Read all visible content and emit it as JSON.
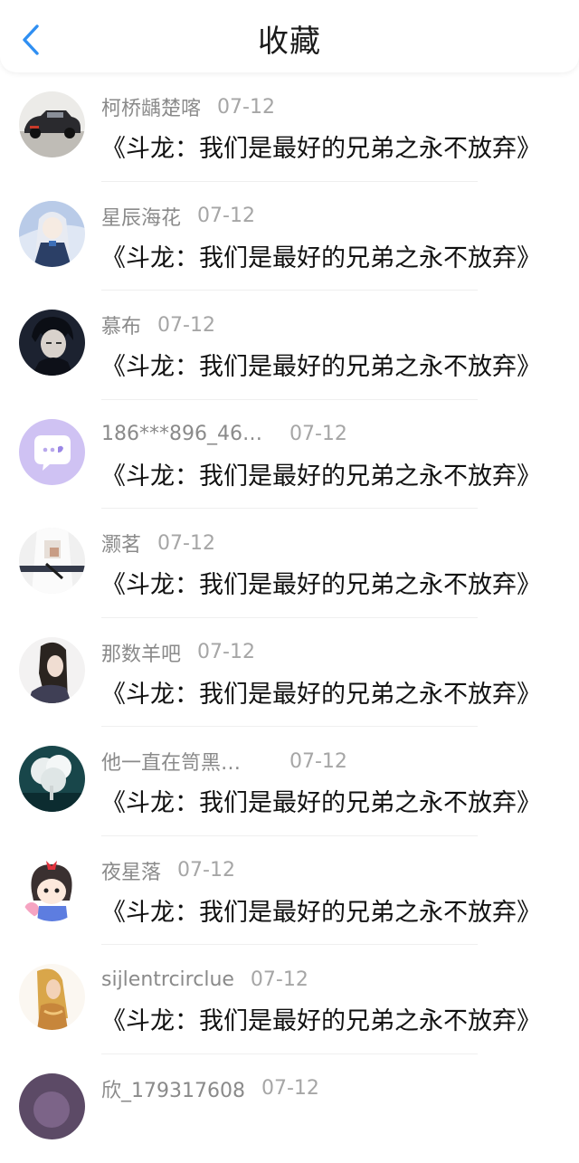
{
  "header": {
    "title": "收藏",
    "back_icon": "chevron-left-icon",
    "accent": "#2f8ff2"
  },
  "items": [
    {
      "name": "柯桥龋楚喀",
      "date": "07-12",
      "text": "《斗龙：我们是最好的兄弟之永不放弃》",
      "avatar": "car-avatar"
    },
    {
      "name": "星辰海花",
      "date": "07-12",
      "text": "《斗龙：我们是最好的兄弟之永不放弃》",
      "avatar": "anime-girl-blue-avatar"
    },
    {
      "name": "慕布",
      "date": "07-12",
      "text": "《斗龙：我们是最好的兄弟之永不放弃》",
      "avatar": "dark-anime-boy-avatar"
    },
    {
      "name": "186***896_469…",
      "date": "07-12",
      "text": "《斗龙：我们是最好的兄弟之永不放弃》",
      "avatar": "default-chat-avatar"
    },
    {
      "name": "灏茗",
      "date": "07-12",
      "text": "《斗龙：我们是最好的兄弟之永不放弃》",
      "avatar": "white-clothes-avatar"
    },
    {
      "name": "那数羊吧",
      "date": "07-12",
      "text": "《斗龙：我们是最好的兄弟之永不放弃》",
      "avatar": "long-hair-girl-avatar"
    },
    {
      "name": "他一直在笥黑…",
      "date": "07-12",
      "text": "《斗龙：我们是最好的兄弟之永不放弃》",
      "avatar": "white-tree-avatar"
    },
    {
      "name": "夜星落",
      "date": "07-12",
      "text": "《斗龙：我们是最好的兄弟之永不放弃》",
      "avatar": "cartoon-girl-avatar"
    },
    {
      "name": "sijlentrcirclue",
      "date": "07-12",
      "text": "《斗龙：我们是最好的兄弟之永不放弃》",
      "avatar": "elf-warrior-avatar"
    },
    {
      "name": "欣_179317608",
      "date": "07-12",
      "text": "",
      "avatar": "purple-avatar"
    }
  ]
}
